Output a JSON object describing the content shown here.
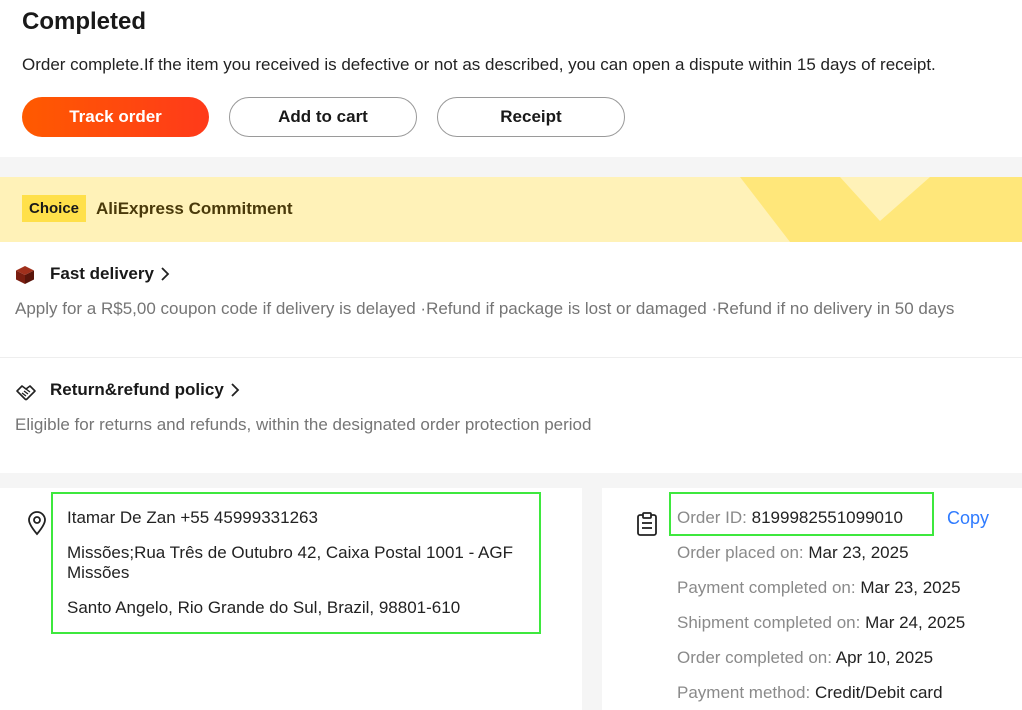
{
  "header": {
    "status_title": "Completed",
    "status_message": "Order complete.If the item you received is defective or not as described, you can open a dispute within 15 days of receipt."
  },
  "actions": {
    "track_label": "Track order",
    "cart_label": "Add to cart",
    "receipt_label": "Receipt"
  },
  "commitment": {
    "badge": "Choice",
    "title": "AliExpress Commitment"
  },
  "fast_delivery": {
    "title": "Fast delivery",
    "description": "Apply for a R$5,00 coupon code if delivery is delayed ·Refund if package is lost or damaged ·Refund if no delivery in 50 days"
  },
  "return_policy": {
    "title": "Return&refund policy",
    "description": "Eligible for returns and refunds, within the designated order protection period"
  },
  "address": {
    "name_phone": "Itamar De Zan +55 45999331263",
    "street_1": "Missões;Rua Três de Outubro 42, Caixa Postal 1001 - AGF",
    "street_2": "Missões",
    "city_line": "Santo Angelo, Rio Grande do Sul, Brazil, 98801-610"
  },
  "order_info": {
    "id_label": "Order ID:",
    "id_value": "8199982551099010",
    "copy_label": "Copy",
    "placed_label": "Order placed on:",
    "placed_value": "Mar 23, 2025",
    "payment_label": "Payment completed on:",
    "payment_value": "Mar 23, 2025",
    "shipment_label": "Shipment completed on:",
    "shipment_value": "Mar 24, 2025",
    "completed_label": "Order completed on:",
    "completed_value": "Apr 10, 2025",
    "method_label": "Payment method:",
    "method_value": "Credit/Debit card"
  },
  "colors": {
    "accent_orange": "#ff4f0a",
    "banner_yellow": "#fff2b8",
    "badge_yellow": "#ffe04a",
    "link_blue": "#2f7bff",
    "highlight_green": "#3ee83e"
  },
  "icons": {
    "delivery": "package-cube-icon",
    "return": "handshake-icon",
    "location": "location-pin-icon",
    "order": "clipboard-icon",
    "chevron": "chevron-right-icon"
  }
}
